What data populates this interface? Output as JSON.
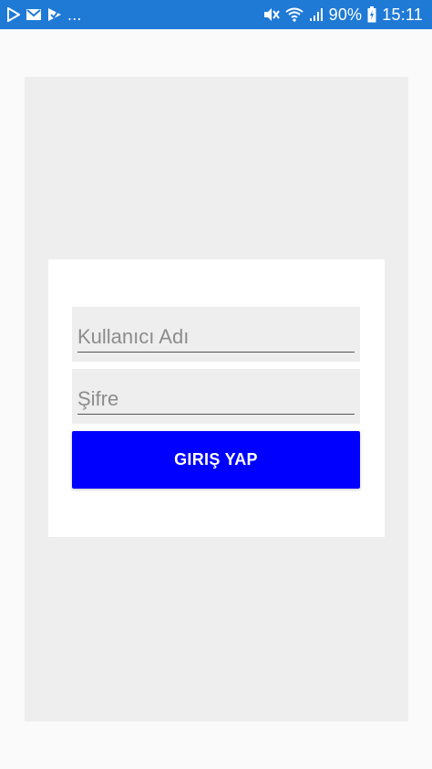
{
  "status_bar": {
    "background": "#1f7ad6",
    "left_icons": [
      "play-store-icon",
      "gmail-icon",
      "notification-check-icon"
    ],
    "overflow": "...",
    "right_icons": [
      "mute-icon",
      "wifi-icon",
      "signal-icon",
      "battery-icon"
    ],
    "battery": "90%",
    "time": "15:11"
  },
  "login": {
    "username_placeholder": "Kullanıcı Adı",
    "password_placeholder": "Şifre",
    "button_label": "GIRIŞ YAP",
    "button_color": "#0000ff"
  }
}
